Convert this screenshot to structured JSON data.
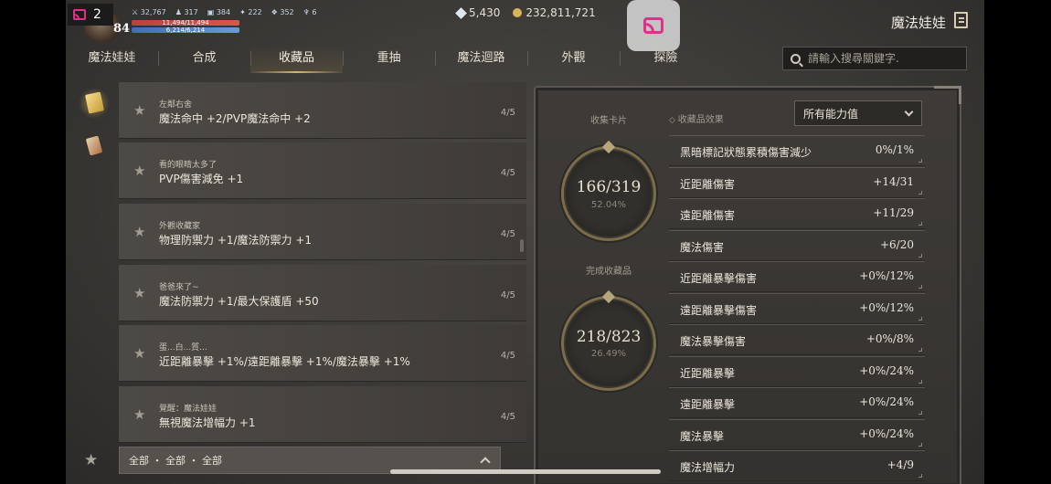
{
  "system": {
    "cast_count": "2"
  },
  "player": {
    "level": "84",
    "stat_power": "32,767",
    "stat_a": "317",
    "stat_b": "384",
    "stat_c": "222",
    "stat_d": "352",
    "stat_e": "6",
    "hp": "11,494/11,494",
    "mp": "6,214/6,214"
  },
  "currency": {
    "diamonds": "5,430",
    "gold": "232,811,721"
  },
  "header": {
    "title": "魔法娃娃"
  },
  "tabs": [
    {
      "label": "魔法娃娃"
    },
    {
      "label": "合成"
    },
    {
      "label": "收藏品"
    },
    {
      "label": "重抽"
    },
    {
      "label": "魔法迴路"
    },
    {
      "label": "外觀"
    },
    {
      "label": "探險"
    }
  ],
  "search": {
    "placeholder": "請輸入搜尋關鍵字."
  },
  "collection_list": [
    {
      "title": "左鄰右舍",
      "desc": "魔法命中 +2/PVP魔法命中 +2",
      "progress": "4/5"
    },
    {
      "title": "看的眼睛太多了",
      "desc": "PVP傷害減免 +1",
      "progress": "4/5"
    },
    {
      "title": "外觀收藏家",
      "desc": "物理防禦力 +1/魔法防禦力 +1",
      "progress": "4/5"
    },
    {
      "title": "爸爸來了~",
      "desc": "魔法防禦力 +1/最大保護盾 +50",
      "progress": "4/5"
    },
    {
      "title": "蛋...白...質...",
      "desc": "近距離暴擊 +1%/遠距離暴擊 +1%/魔法暴擊 +1%",
      "progress": "4/5"
    },
    {
      "title": "覺醒：魔法娃娃",
      "desc": "無視魔法增幅力 +1",
      "progress": "4/5"
    }
  ],
  "filter": {
    "label": "全部 ・ 全部 ・ 全部"
  },
  "summary": {
    "cards_label": "收集卡片",
    "cards_value": "166/319",
    "cards_pct": "52.04%",
    "completed_label": "完成收藏品",
    "completed_value": "218/823",
    "completed_pct": "26.49%"
  },
  "effects": {
    "label": "收藏品效果",
    "selected": "所有能力值",
    "items": [
      {
        "name": "黑暗標記狀態累積傷害減少",
        "value": "0%/1%"
      },
      {
        "name": "近距離傷害",
        "value": "+14/31"
      },
      {
        "name": "遠距離傷害",
        "value": "+11/29"
      },
      {
        "name": "魔法傷害",
        "value": "+6/20"
      },
      {
        "name": "近距離暴擊傷害",
        "value": "+0%/12%"
      },
      {
        "name": "遠距離暴擊傷害",
        "value": "+0%/12%"
      },
      {
        "name": "魔法暴擊傷害",
        "value": "+0%/8%"
      },
      {
        "name": "近距離暴擊",
        "value": "+0%/24%"
      },
      {
        "name": "遠距離暴擊",
        "value": "+0%/24%"
      },
      {
        "name": "魔法暴擊",
        "value": "+0%/24%"
      },
      {
        "name": "魔法增幅力",
        "value": "+4/9"
      }
    ]
  }
}
